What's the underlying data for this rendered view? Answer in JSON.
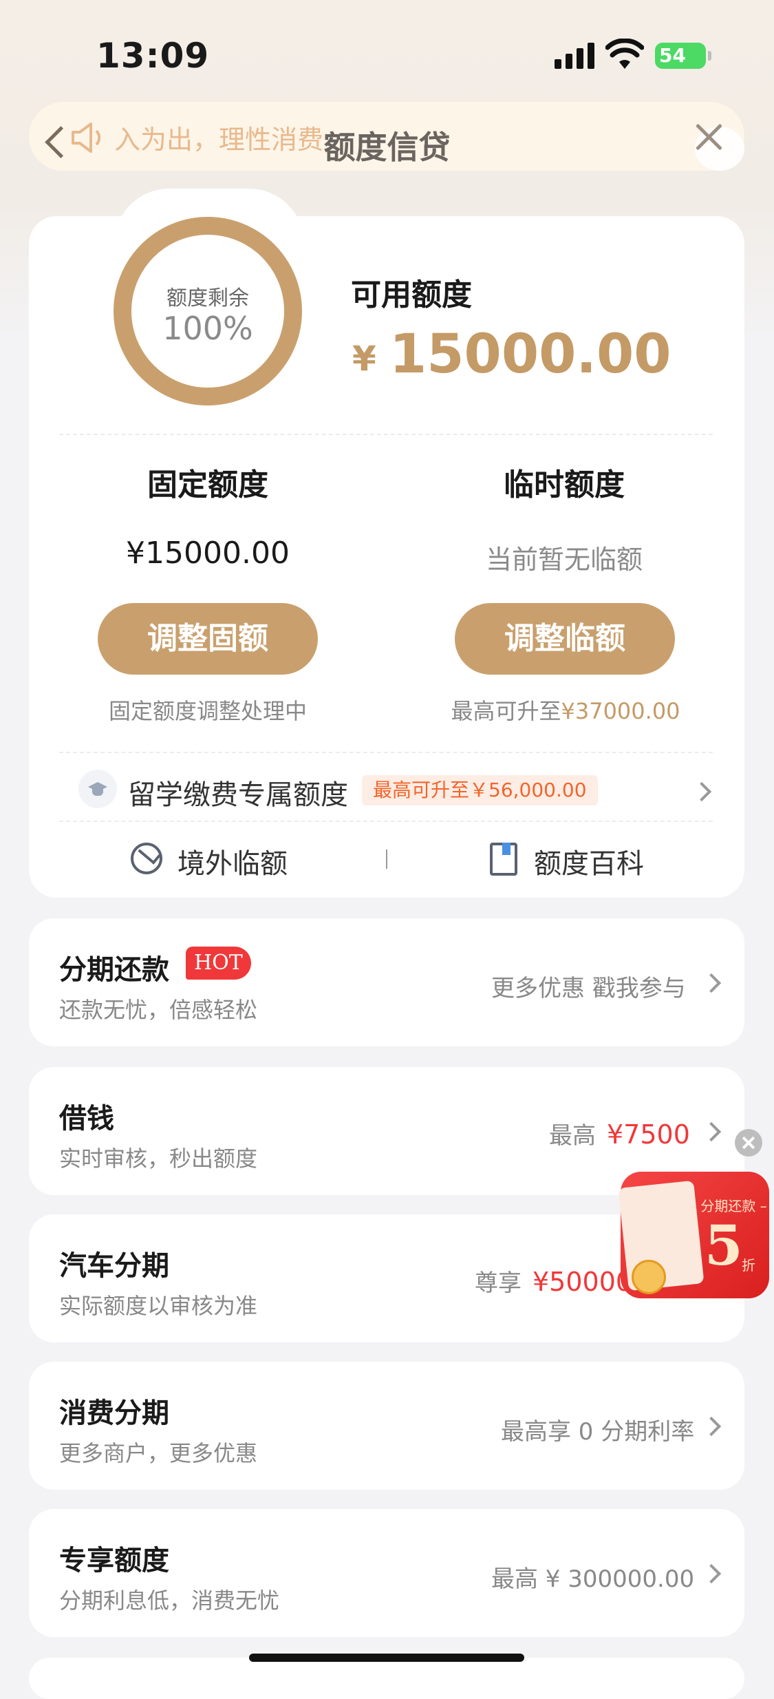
{
  "status_bar": {
    "time": "13:09",
    "battery": "54"
  },
  "notice": {
    "text": "入为出，理性消费"
  },
  "nav": {
    "title": "额度信贷"
  },
  "summary": {
    "ring_label": "额度剩余",
    "ring_percent": "100%",
    "ring_fraction": 1.0,
    "available_label": "可用额度",
    "currency": "¥",
    "available_amount": "15000.00"
  },
  "fixed": {
    "title": "固定额度",
    "value": "¥15000.00",
    "button": "调整固额",
    "note": "固定额度调整处理中"
  },
  "temporary": {
    "title": "临时额度",
    "value": "当前暂无临额",
    "button": "调整临额",
    "note_prefix": "最高可升至",
    "note_amount": "¥37000.00"
  },
  "study": {
    "label": "留学缴费专属额度",
    "badge": "最高可升至￥56,000.00"
  },
  "links": {
    "overseas": "境外临额",
    "wiki": "额度百科"
  },
  "items": [
    {
      "title": "分期还款",
      "badge": "HOT",
      "subtitle": "还款无忧，倍感轻松",
      "right": "更多优惠 戳我参与"
    },
    {
      "title": "借钱",
      "subtitle": "实时审核，秒出额度",
      "right_prefix": "最高",
      "right_amount": "¥7500"
    },
    {
      "title": "汽车分期",
      "subtitle": "实际额度以审核为准",
      "right_prefix": "尊享",
      "right_amount": "¥50000"
    },
    {
      "title": "消费分期",
      "subtitle": "更多商户，更多优惠",
      "right": "最高享 0 分期利率"
    },
    {
      "title": "专享额度",
      "subtitle": "分期利息低，消费无忧",
      "right": "最高 ¥ 300000.00"
    }
  ],
  "promo": {
    "tag": "– 分期还款 –",
    "number": "5",
    "unit": "折"
  },
  "colors": {
    "gold": "#C9A06D",
    "red": "#F0383A",
    "orange": "#F2652C"
  }
}
